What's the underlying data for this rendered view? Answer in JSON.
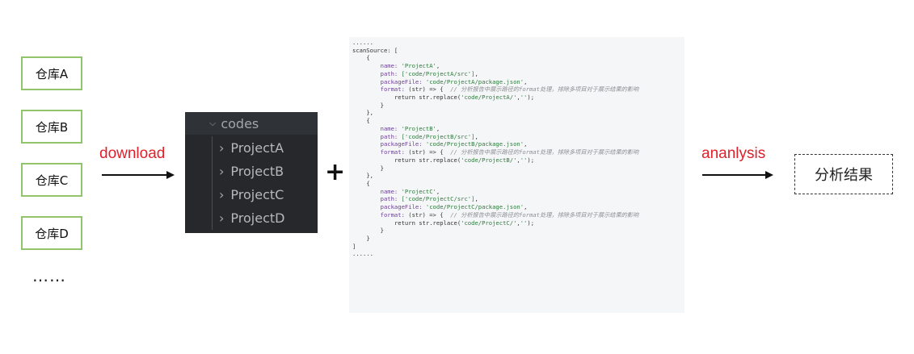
{
  "repos": [
    "仓库A",
    "仓库B",
    "仓库C",
    "仓库D"
  ],
  "repos_more": "……",
  "download_label": "download",
  "tree": {
    "root": "codes",
    "items": [
      "ProjectA",
      "ProjectB",
      "ProjectC",
      "ProjectD"
    ]
  },
  "plus_sign": "+",
  "code_lines": [
    {
      "indent": 0,
      "parts": [
        {
          "t": "......",
          "c": ""
        }
      ]
    },
    {
      "indent": 0,
      "parts": [
        {
          "t": "scanSource: [",
          "c": ""
        }
      ]
    },
    {
      "indent": 1,
      "parts": [
        {
          "t": "{",
          "c": ""
        }
      ]
    },
    {
      "indent": 2,
      "parts": [
        {
          "t": "name: ",
          "c": "k"
        },
        {
          "t": "'ProjectA'",
          "c": "s"
        },
        {
          "t": ",",
          "c": ""
        }
      ]
    },
    {
      "indent": 2,
      "parts": [
        {
          "t": "path: ",
          "c": "k"
        },
        {
          "t": "['code/ProjectA/src']",
          "c": "s"
        },
        {
          "t": ",",
          "c": ""
        }
      ]
    },
    {
      "indent": 2,
      "parts": [
        {
          "t": "packageFile: ",
          "c": "k"
        },
        {
          "t": "'code/ProjectA/package.json'",
          "c": "s"
        },
        {
          "t": ",",
          "c": ""
        }
      ]
    },
    {
      "indent": 2,
      "parts": [
        {
          "t": "format: ",
          "c": "k"
        },
        {
          "t": "(str) => {  ",
          "c": ""
        },
        {
          "t": "// 分析报告中展示路径的format处理，排除多项目对于展示结果的影响",
          "c": "c"
        }
      ]
    },
    {
      "indent": 3,
      "parts": [
        {
          "t": "return str.replace(",
          "c": ""
        },
        {
          "t": "'code/ProjectA/'",
          "c": "s"
        },
        {
          "t": ",",
          "c": ""
        },
        {
          "t": "''",
          "c": "s"
        },
        {
          "t": ");",
          "c": ""
        }
      ]
    },
    {
      "indent": 2,
      "parts": [
        {
          "t": "}",
          "c": ""
        }
      ]
    },
    {
      "indent": 1,
      "parts": [
        {
          "t": "},",
          "c": ""
        }
      ]
    },
    {
      "indent": 1,
      "parts": [
        {
          "t": "{",
          "c": ""
        }
      ]
    },
    {
      "indent": 2,
      "parts": [
        {
          "t": "name: ",
          "c": "k"
        },
        {
          "t": "'ProjectB'",
          "c": "s"
        },
        {
          "t": ",",
          "c": ""
        }
      ]
    },
    {
      "indent": 2,
      "parts": [
        {
          "t": "path: ",
          "c": "k"
        },
        {
          "t": "['code/ProjectB/src']",
          "c": "s"
        },
        {
          "t": ",",
          "c": ""
        }
      ]
    },
    {
      "indent": 2,
      "parts": [
        {
          "t": "packageFile: ",
          "c": "k"
        },
        {
          "t": "'code/ProjectB/package.json'",
          "c": "s"
        },
        {
          "t": ",",
          "c": ""
        }
      ]
    },
    {
      "indent": 2,
      "parts": [
        {
          "t": "format: ",
          "c": "k"
        },
        {
          "t": "(str) => {  ",
          "c": ""
        },
        {
          "t": "// 分析报告中展示路径的format处理，排除多项目对于展示结果的影响",
          "c": "c"
        }
      ]
    },
    {
      "indent": 3,
      "parts": [
        {
          "t": "return str.replace(",
          "c": ""
        },
        {
          "t": "'code/ProjectB/'",
          "c": "s"
        },
        {
          "t": ",",
          "c": ""
        },
        {
          "t": "''",
          "c": "s"
        },
        {
          "t": ");",
          "c": ""
        }
      ]
    },
    {
      "indent": 2,
      "parts": [
        {
          "t": "}",
          "c": ""
        }
      ]
    },
    {
      "indent": 1,
      "parts": [
        {
          "t": "},",
          "c": ""
        }
      ]
    },
    {
      "indent": 1,
      "parts": [
        {
          "t": "{",
          "c": ""
        }
      ]
    },
    {
      "indent": 2,
      "parts": [
        {
          "t": "name: ",
          "c": "k"
        },
        {
          "t": "'ProjectC'",
          "c": "s"
        },
        {
          "t": ",",
          "c": ""
        }
      ]
    },
    {
      "indent": 2,
      "parts": [
        {
          "t": "path: ",
          "c": "k"
        },
        {
          "t": "['code/ProjectC/src']",
          "c": "s"
        },
        {
          "t": ",",
          "c": ""
        }
      ]
    },
    {
      "indent": 2,
      "parts": [
        {
          "t": "packageFile: ",
          "c": "k"
        },
        {
          "t": "'code/ProjectC/package.json'",
          "c": "s"
        },
        {
          "t": ",",
          "c": ""
        }
      ]
    },
    {
      "indent": 2,
      "parts": [
        {
          "t": "format: ",
          "c": "k"
        },
        {
          "t": "(str) => {  ",
          "c": ""
        },
        {
          "t": "// 分析报告中展示路径的format处理，排除多项目对于展示结果的影响",
          "c": "c"
        }
      ]
    },
    {
      "indent": 3,
      "parts": [
        {
          "t": "return str.replace(",
          "c": ""
        },
        {
          "t": "'code/ProjectC/'",
          "c": "s"
        },
        {
          "t": ",",
          "c": ""
        },
        {
          "t": "''",
          "c": "s"
        },
        {
          "t": ");",
          "c": ""
        }
      ]
    },
    {
      "indent": 2,
      "parts": [
        {
          "t": "}",
          "c": ""
        }
      ]
    },
    {
      "indent": 1,
      "parts": [
        {
          "t": "}",
          "c": ""
        }
      ]
    },
    {
      "indent": 0,
      "parts": [
        {
          "t": "]",
          "c": ""
        }
      ]
    },
    {
      "indent": 0,
      "parts": [
        {
          "t": "......",
          "c": ""
        }
      ]
    }
  ],
  "analysis_label": "ananlysis",
  "result_label": "分析结果",
  "colors": {
    "repo_border": "#92c56b",
    "label_red": "#e0212b",
    "tree_bg": "#26282b",
    "code_bg": "#f5f6f7"
  }
}
